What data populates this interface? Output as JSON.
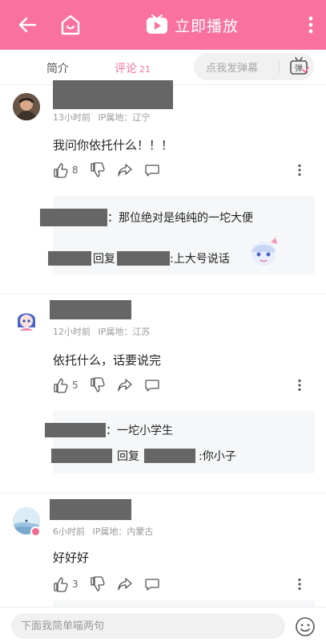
{
  "header": {
    "play_label": "立即播放"
  },
  "tabs": {
    "intro": "简介",
    "comments": "评论",
    "comments_count": "21",
    "danmaku_placeholder": "点我发弹幕",
    "danmaku_button": "弹"
  },
  "comments": [
    {
      "time": "13小时前",
      "ip": "IP属地：辽宁",
      "text": "我问你依托什么！！！",
      "likes": "8",
      "replies": [
        {
          "text": "：那位绝对是纯纯的一坨大便"
        },
        {
          "reply_word": "回复",
          "text": ":上大号说话"
        }
      ]
    },
    {
      "time": "12小时前",
      "ip": "IP属地：江苏",
      "text": "依托什么，话要说完",
      "likes": "5",
      "replies": [
        {
          "text": "：一坨小学生"
        },
        {
          "reply_word": "回复",
          "text": ":你小子"
        }
      ]
    },
    {
      "time": "6小时前",
      "ip": "IP属地：内蒙古",
      "text": "好好好",
      "likes": "3"
    }
  ],
  "bottom": {
    "input_placeholder": "下面我简单喵两句"
  },
  "colors": {
    "accent": "#f8719f",
    "reply_bg": "#f6f7f8",
    "redaction": "#666666"
  }
}
